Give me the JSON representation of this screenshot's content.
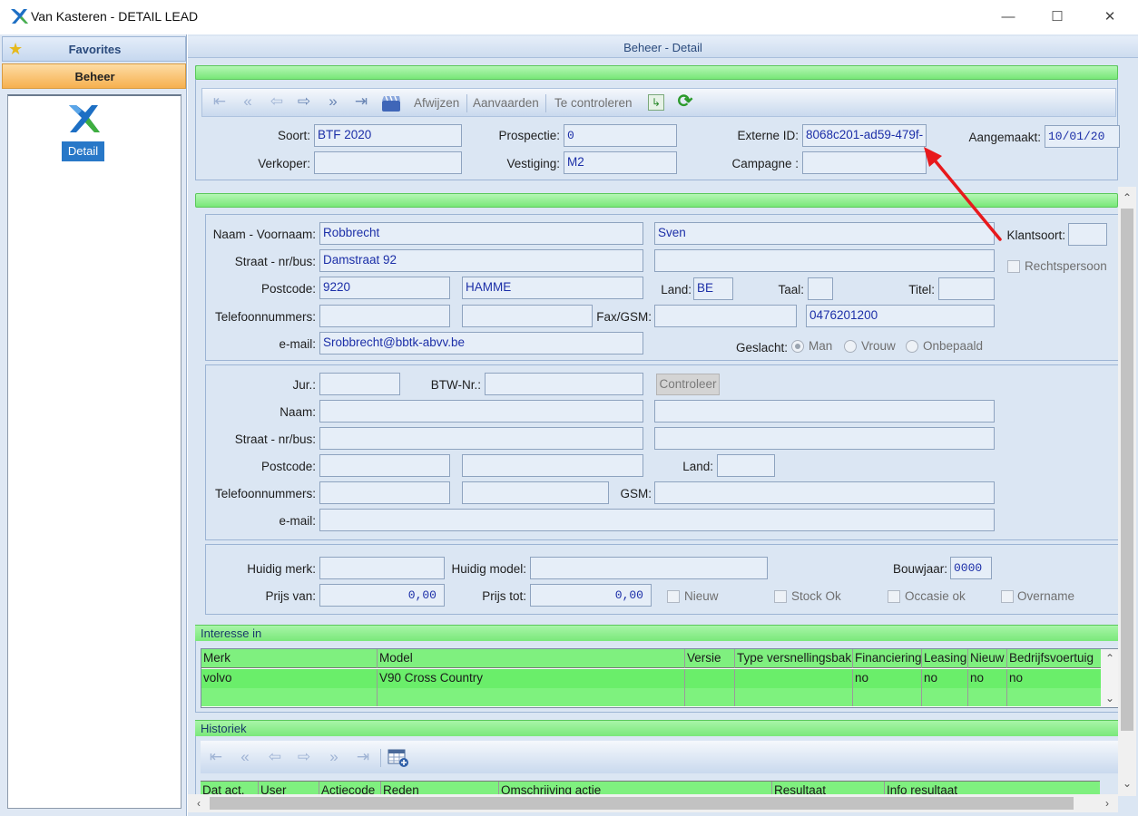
{
  "window": {
    "title": "Van Kasteren - DETAIL LEAD",
    "minimize": "—",
    "maximize": "☐",
    "close": "✕"
  },
  "sidebar": {
    "favorites_label": "Favorites",
    "beheer_label": "Beheer",
    "detail_label": "Detail"
  },
  "main": {
    "title": "Beheer - Detail"
  },
  "toolbar": {
    "first": "⇤",
    "prev_page": "«",
    "prev": "⇦",
    "next": "⇨",
    "next_page": "»",
    "last": "⇥",
    "afwijzen": "Afwijzen",
    "aanvaarden": "Aanvaarden",
    "te_controleren": "Te controleren",
    "export_icon": "↳",
    "refresh_icon": "⟳"
  },
  "header_fields": {
    "soort_label": "Soort:",
    "soort": "BTF 2020",
    "verkoper_label": "Verkoper:",
    "verkoper": "",
    "prospectie_label": "Prospectie:",
    "prospectie": "0",
    "vestiging_label": "Vestiging:",
    "vestiging": "M2",
    "externe_id_label": "Externe ID:",
    "externe_id": "8068c201-ad59-479f-",
    "campagne_label": "Campagne :",
    "campagne": "",
    "aangemaakt_label": "Aangemaakt:",
    "aangemaakt": "10/01/20"
  },
  "person": {
    "naam_label": "Naam - Voornaam:",
    "naam": "Robbrecht",
    "voornaam": "Sven",
    "klantsoort_label": "Klantsoort:",
    "klantsoort": "",
    "straat_label": "Straat - nr/bus:",
    "straat": "Damstraat 92",
    "straat2": "",
    "rechtspersoon_label": "Rechtspersoon",
    "postcode_label": "Postcode:",
    "postcode": "9220",
    "gemeente": "HAMME",
    "land_label": "Land:",
    "land": "BE",
    "taal_label": "Taal:",
    "taal": "",
    "titel_label": "Titel:",
    "titel": "",
    "telefoon_label": "Telefoonnummers:",
    "telefoon1": "",
    "telefoon2": "",
    "fax_label": "Fax/GSM:",
    "fax": "",
    "gsm": "0476201200",
    "email_label": "e-mail:",
    "email": "Srobbrecht@bbtk-abvv.be",
    "geslacht_label": "Geslacht:",
    "man": "Man",
    "vrouw": "Vrouw",
    "onbepaald": "Onbepaald"
  },
  "company": {
    "jur_label": "Jur.:",
    "jur": "",
    "btw_label": "BTW-Nr.:",
    "btw": "",
    "controleer": "Controleer",
    "naam_label": "Naam:",
    "straat_label": "Straat - nr/bus:",
    "postcode_label": "Postcode:",
    "land_label": "Land:",
    "telefoon_label": "Telefoonnummers:",
    "gsm_label": "GSM:",
    "email_label": "e-mail:"
  },
  "vehicle": {
    "huidig_merk_label": "Huidig merk:",
    "huidig_merk": "",
    "huidig_model_label": "Huidig model:",
    "huidig_model": "",
    "bouwjaar_label": "Bouwjaar:",
    "bouwjaar": "0000",
    "prijs_van_label": "Prijs van:",
    "prijs_van": "0,00",
    "prijs_tot_label": "Prijs tot:",
    "prijs_tot": "0,00",
    "nieuw_label": "Nieuw",
    "stock_ok_label": "Stock Ok",
    "occasie_ok_label": "Occasie ok",
    "overname_label": "Overname"
  },
  "interesse": {
    "title": "Interesse in",
    "columns": [
      "Merk",
      "Model",
      "Versie",
      "Type versnellingsbak",
      "Financiering",
      "Leasing",
      "Nieuw",
      "Bedrijfsvoertuig"
    ],
    "rows": [
      [
        "volvo",
        "V90 Cross Country",
        "",
        "",
        "no",
        "no",
        "no",
        "no"
      ]
    ]
  },
  "historiek": {
    "title": "Historiek",
    "columns": [
      "Dat act.",
      "User",
      "Actiecode",
      "Reden",
      "Omschrijving actie",
      "Resultaat",
      "Info resultaat"
    ],
    "add_icon": "table-add-icon"
  },
  "colors": {
    "annotation_arrow": "#e8191c",
    "grid_green": "#6aee6a",
    "panel_blue": "#dbe6f3"
  }
}
